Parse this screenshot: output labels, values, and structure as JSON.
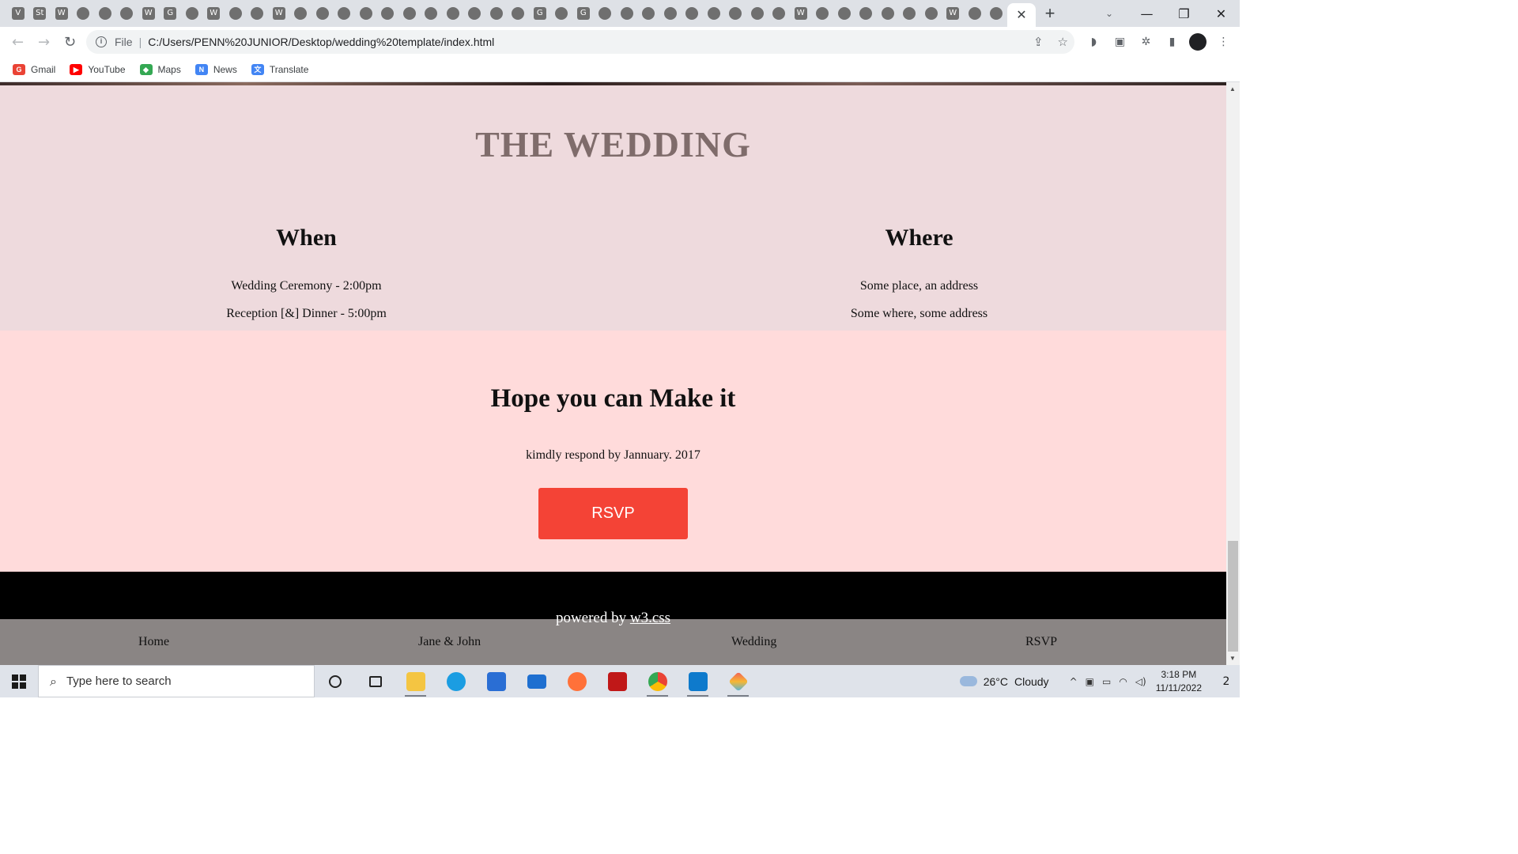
{
  "browser": {
    "tab_favicons": [
      "V",
      "St",
      "W",
      "",
      "",
      "",
      "W",
      "G",
      "",
      "W",
      "",
      "",
      "W",
      "",
      "",
      "",
      "",
      "",
      "",
      "",
      "",
      "",
      "",
      "",
      "G",
      "",
      "G",
      "",
      "",
      "",
      "",
      "",
      "",
      "",
      "",
      "",
      "W",
      "",
      "",
      "",
      "",
      "",
      "",
      "W",
      "",
      ""
    ],
    "active_tab_close": "✕",
    "new_tab": "+",
    "tab_search": "⌄",
    "window_controls": {
      "minimize": "—",
      "maximize": "❐",
      "close": "✕"
    },
    "nav": {
      "back": "←",
      "forward": "→",
      "reload": "↻"
    },
    "omnibox": {
      "scheme_label": "File",
      "separator": "|",
      "url": "C:/Users/PENN%20JUNIOR/Desktop/wedding%20template/index.html"
    },
    "omnibox_actions": {
      "share": "⇪",
      "bookmark": "☆"
    },
    "extensions": {
      "ext1": "◗",
      "ext2": "▣",
      "puzzle": "✲",
      "sidepanel": "▮",
      "menu": "⋮"
    },
    "bookmarks": [
      {
        "label": "Gmail",
        "icon": "G",
        "color": "#ea4335"
      },
      {
        "label": "YouTube",
        "icon": "▶",
        "color": "#ff0000"
      },
      {
        "label": "Maps",
        "icon": "◆",
        "color": "#34a853"
      },
      {
        "label": "News",
        "icon": "N",
        "color": "#4285f4"
      },
      {
        "label": "Translate",
        "icon": "文",
        "color": "#4285f4"
      }
    ]
  },
  "page": {
    "wedding": {
      "title": "THE WEDDING",
      "when": {
        "heading": "When",
        "line1": "Wedding Ceremony - 2:00pm",
        "line2": "Reception [&] Dinner - 5:00pm"
      },
      "where": {
        "heading": "Where",
        "line1": "Some place, an address",
        "line2": "Some where, some address"
      }
    },
    "rsvp": {
      "title": "Hope you can Make it",
      "note": "kimdly respond by Jannuary. 2017",
      "button": "RSVP"
    },
    "footer": {
      "powered_prefix": "powered by ",
      "powered_link": "w3.css"
    },
    "bottom_nav": [
      "Home",
      "Jane & John",
      "Wedding",
      "RSVP"
    ]
  },
  "taskbar": {
    "search_placeholder": "Type here to search",
    "apps": [
      "cortana",
      "task-view",
      "file-explorer",
      "edge",
      "store",
      "mail",
      "firefox",
      "mcafee",
      "chrome",
      "vscode",
      "git"
    ],
    "weather": {
      "temp": "26°C",
      "condition": "Cloudy"
    },
    "clock": {
      "time": "3:18 PM",
      "date": "11/11/2022"
    },
    "tray": {
      "chevron": "^",
      "meet": "▣",
      "battery": "▭",
      "wifi": "◠",
      "volume": "◁)"
    },
    "notifications": "2"
  },
  "colors": {
    "wedding_bg": "#eedadd",
    "rsvp_bg": "#ffdbdb",
    "rsvp_button": "#f44336",
    "title_color": "#7f6c6b",
    "footer_bg": "#000000",
    "bottom_nav_bg": "#8a8584"
  }
}
